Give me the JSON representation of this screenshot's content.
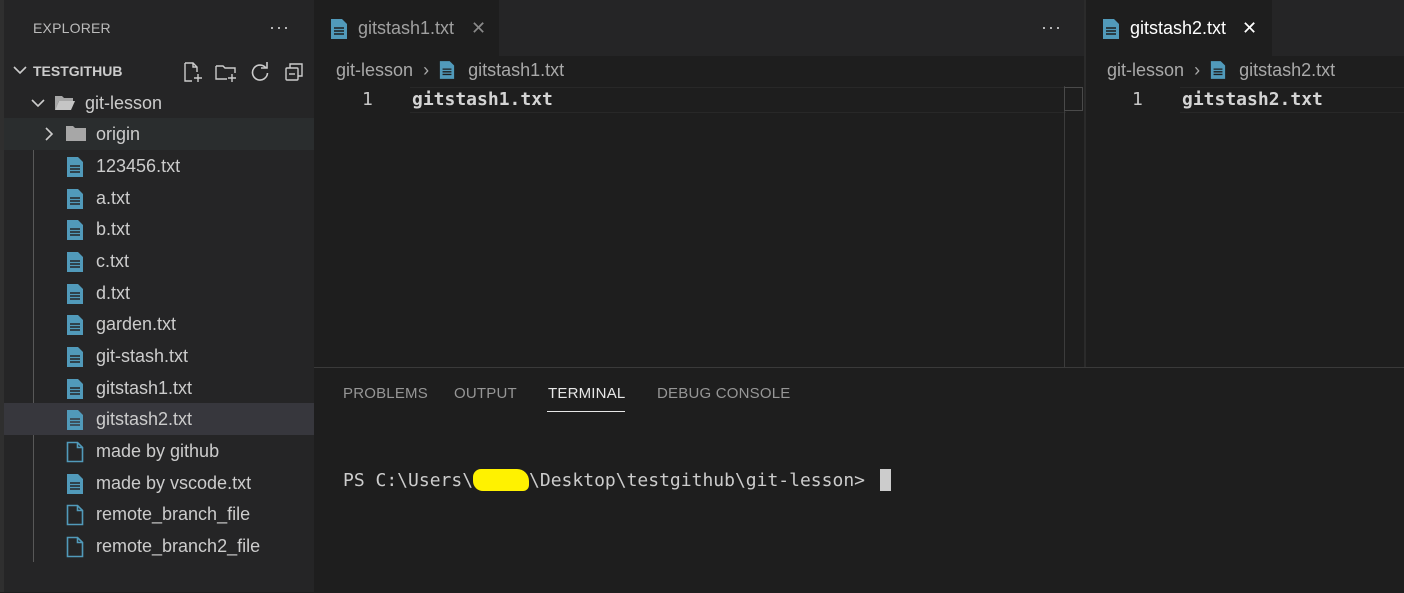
{
  "sidebar": {
    "title": "EXPLORER",
    "more_label": "···",
    "section_title": "TESTGITHUB",
    "actions": [
      "new-file-icon",
      "new-folder-icon",
      "refresh-icon",
      "collapse-all-icon"
    ],
    "tree": [
      {
        "label": "git-lesson",
        "kind": "folder-open"
      },
      {
        "label": "origin",
        "kind": "folder-closed"
      },
      {
        "label": "123456.txt",
        "kind": "file"
      },
      {
        "label": "a.txt",
        "kind": "file"
      },
      {
        "label": "b.txt",
        "kind": "file"
      },
      {
        "label": "c.txt",
        "kind": "file"
      },
      {
        "label": "d.txt",
        "kind": "file"
      },
      {
        "label": "garden.txt",
        "kind": "file"
      },
      {
        "label": "git-stash.txt",
        "kind": "file"
      },
      {
        "label": "gitstash1.txt",
        "kind": "file"
      },
      {
        "label": "gitstash2.txt",
        "kind": "file",
        "selected": true
      },
      {
        "label": "made by github",
        "kind": "file-plain"
      },
      {
        "label": "made by vscode.txt",
        "kind": "file"
      },
      {
        "label": "remote_branch_file",
        "kind": "file-plain"
      },
      {
        "label": "remote_branch2_file",
        "kind": "file-plain"
      }
    ]
  },
  "editor_left": {
    "tab_label": "gitstash1.txt",
    "close_glyph": "✕",
    "more_label": "···",
    "breadcrumb_folder": "git-lesson",
    "breadcrumb_sep": "›",
    "breadcrumb_file": "gitstash1.txt",
    "line_number": "1",
    "line_text": "gitstash1.txt"
  },
  "editor_right": {
    "tab_label": "gitstash2.txt",
    "close_glyph": "✕",
    "breadcrumb_folder": "git-lesson",
    "breadcrumb_sep": "›",
    "breadcrumb_file": "gitstash2.txt",
    "line_number": "1",
    "line_text": "gitstash2.txt"
  },
  "panel": {
    "tabs": [
      "PROBLEMS",
      "OUTPUT",
      "TERMINAL",
      "DEBUG CONSOLE"
    ],
    "active_tab": "TERMINAL",
    "prompt_prefix": "PS C:\\Users\\",
    "prompt_suffix": "\\Desktop\\testgithub\\git-lesson> "
  },
  "colors": {
    "file_icon": "#519aba",
    "redaction": "#fff200",
    "sidebar_bg": "#252526",
    "editor_bg": "#1e1e1e"
  }
}
